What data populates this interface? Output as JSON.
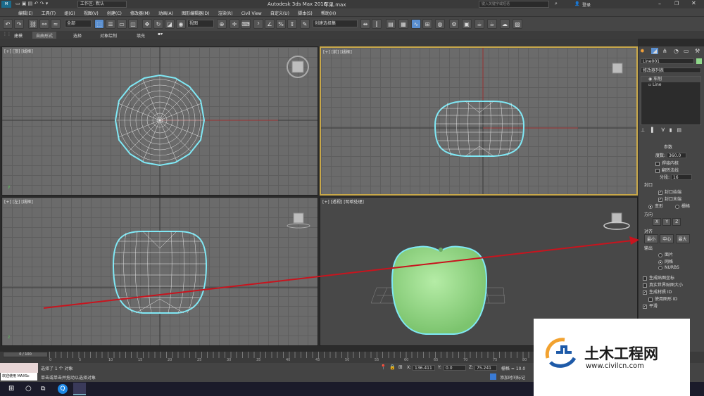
{
  "window": {
    "title": "Autodesk 3ds Max 2016",
    "file": "苹果.max",
    "workspace": "工作区: 默认",
    "search_placeholder": "键入关键字或短语",
    "login": "登录"
  },
  "menu": [
    "编辑(E)",
    "工具(T)",
    "组(G)",
    "视图(V)",
    "创建(C)",
    "修改器(M)",
    "动画(A)",
    "图形编辑器(D)",
    "渲染(R)",
    "Civil View",
    "自定义(U)",
    "脚本(S)",
    "帮助(H)"
  ],
  "toolbar": {
    "selection_filter": "全部",
    "coord_system": "视图",
    "named_selection": "创建选择集"
  },
  "ribbon": [
    "建模",
    "自由形式",
    "选择",
    "对象绘制",
    "填充"
  ],
  "viewports": {
    "top": "[+] [顶] [线框]",
    "front": "[+] [前] [线框]",
    "left": "[+] [左] [线框]",
    "persp": "[+] [透视] [明暗处理]"
  },
  "panel": {
    "object_name": "Line001",
    "modifier_list": "修改器列表",
    "stack": [
      "车削",
      "Line"
    ],
    "params_title": "参数",
    "degrees_label": "度数:",
    "degrees_value": "360.0",
    "weld_core": "焊接内核",
    "flip_normals": "翻转法线",
    "segments_label": "分段:",
    "segments_value": "16",
    "capping_title": "封口",
    "cap_start": "封口始端",
    "cap_end": "封口末端",
    "morph": "变形",
    "grid": "栅格",
    "direction_title": "方向",
    "dir_x": "X",
    "dir_y": "Y",
    "dir_z": "Z",
    "align_title": "对齐",
    "align_min": "最小",
    "align_center": "中心",
    "align_max": "最大",
    "output_title": "输出",
    "out_patch": "面片",
    "out_mesh": "网格",
    "out_nurbs": "NURBS",
    "gen_mapping": "生成贴图坐标",
    "real_world": "真实世界贴图大小",
    "gen_material_id": "生成材质 ID",
    "use_shape_id": "使用图形 ID",
    "smooth": "平滑"
  },
  "timeline": {
    "frame": "0 / 100",
    "ticks": [
      "0",
      "5",
      "10",
      "15",
      "20",
      "25",
      "30",
      "35",
      "40",
      "45",
      "50",
      "55",
      "60",
      "65",
      "70",
      "75",
      "80",
      "85",
      "90"
    ]
  },
  "status": {
    "welcome": "欢迎使用 MAXSc",
    "selected": "选择了 1 个 对象",
    "prompt": "单击或单击并拖动以选择对象",
    "x_label": "X:",
    "x_value": "136.411",
    "y_label": "Y:",
    "y_value": "0.0",
    "z_label": "Z:",
    "z_value": "75.241",
    "grid": "栅格 = 10.0",
    "add_time_tag": "添加时间标记"
  },
  "watermark": {
    "cn": "土木工程网",
    "url": "www.civilcn.com"
  },
  "colors": {
    "selection_cyan": "#7fe8f5",
    "apple_green": "#9edb8f",
    "arrow_red": "#c8141e",
    "active_border": "#c8a84a"
  }
}
